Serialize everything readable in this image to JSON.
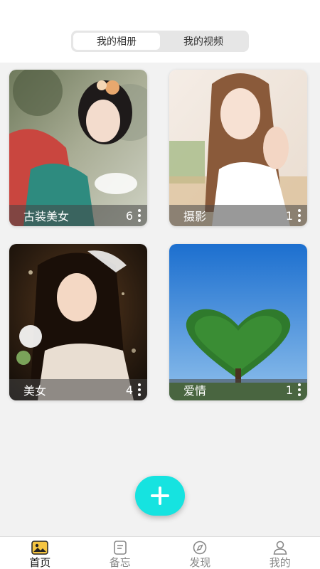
{
  "segment": {
    "items": [
      {
        "label": "我的相册",
        "active": true
      },
      {
        "label": "我的视频",
        "active": false
      }
    ]
  },
  "albums": [
    {
      "name": "古装美女",
      "count": "6"
    },
    {
      "name": "摄影",
      "count": "1"
    },
    {
      "name": "美女",
      "count": "4"
    },
    {
      "name": "爱情",
      "count": "1"
    }
  ],
  "fab": {
    "icon": "plus-icon",
    "color": "#16e3e0"
  },
  "tabbar": {
    "tabs": [
      {
        "label": "首页",
        "icon": "photo-album-icon",
        "active": true
      },
      {
        "label": "备忘",
        "icon": "memo-icon",
        "active": false
      },
      {
        "label": "发现",
        "icon": "compass-icon",
        "active": false
      },
      {
        "label": "我的",
        "icon": "user-icon",
        "active": false
      }
    ]
  }
}
